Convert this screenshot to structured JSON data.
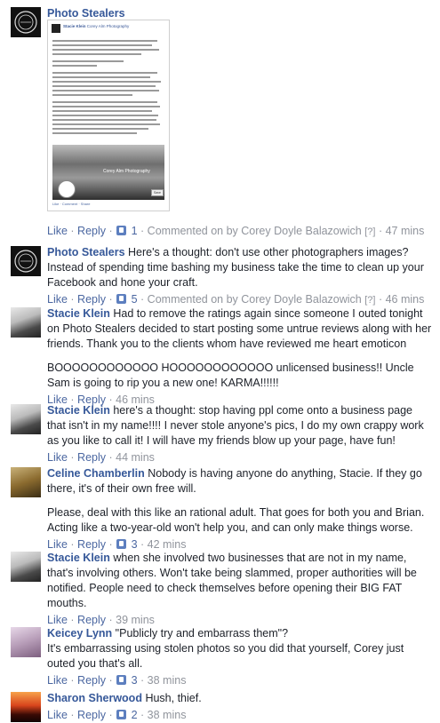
{
  "action_labels": {
    "like": "Like",
    "reply": "Reply",
    "separator": " · "
  },
  "comments": [
    {
      "author": "Photo Stealers",
      "avatar_icon": "photo-stealers-logo-icon",
      "attachment": {
        "poster_name": "Stacie Klein",
        "mentioned_page": "Corey Alm Photography",
        "photo_caption": "Corey Alm Photography",
        "save_label": "Save",
        "footer": "Like · Comment · Share"
      },
      "likes": "1",
      "commented_on_by": "Commented on by Corey Doyle Balazowich",
      "bracket": "[?]",
      "time": "47 mins"
    },
    {
      "author": "Photo Stealers",
      "avatar_icon": "photo-stealers-logo-icon",
      "text": "Here's a thought: don't use other photographers images? Instead of spending time bashing my business take the time to clean up your Facebook and hone your craft.",
      "likes": "5",
      "commented_on_by": "Commented on by Corey Doyle Balazowich",
      "bracket": "[?]",
      "time": "46 mins"
    },
    {
      "author": "Stacie Klein",
      "text": "Had to remove the ratings again since someone I outed tonight on Photo Stealers decided to start posting some untrue reviews along with her friends. Thank you to the clients whom have reviewed me heart emoticon",
      "text2": "BOOOOOOOOOOOO HOOOOOOOOOOOO unlicensed business!! Uncle Sam is going to rip you a new one! KARMA!!!!!!",
      "time": "46 mins"
    },
    {
      "author": "Stacie Klein",
      "text": "here's a thought: stop having ppl come onto a business page that isn't in my name!!!! I never stole anyone's pics, I do my own crappy work as you like to call it! I will have my friends blow up your page, have fun!",
      "time": "44 mins"
    },
    {
      "author": "Celine Chamberlin",
      "text": "Nobody is having anyone do anything, Stacie. If they go there, it's of their own free will.",
      "text2": "Please, deal with this like an rational adult. That goes for both you and Brian. Acting like a two-year-old won't help you, and can only make things worse.",
      "likes": "3",
      "time": "42 mins"
    },
    {
      "author": "Stacie Klein",
      "text": "when she involved two businesses that are not in my name, that's involving others. Won't take being slammed, proper authorities will be notified. People need to check themselves before opening their BIG FAT mouths.",
      "time": "39 mins"
    },
    {
      "author": "Keicey Lynn",
      "text": "\"Publicly try and embarrass them\"?",
      "text2": "It's embarrassing using stolen photos so you did that yourself, Corey just outed you that's all.",
      "likes": "3",
      "time": "38 mins"
    },
    {
      "author": "Sharon Sherwood",
      "text": "Hush, thief.",
      "likes": "2",
      "time": "38 mins"
    }
  ]
}
